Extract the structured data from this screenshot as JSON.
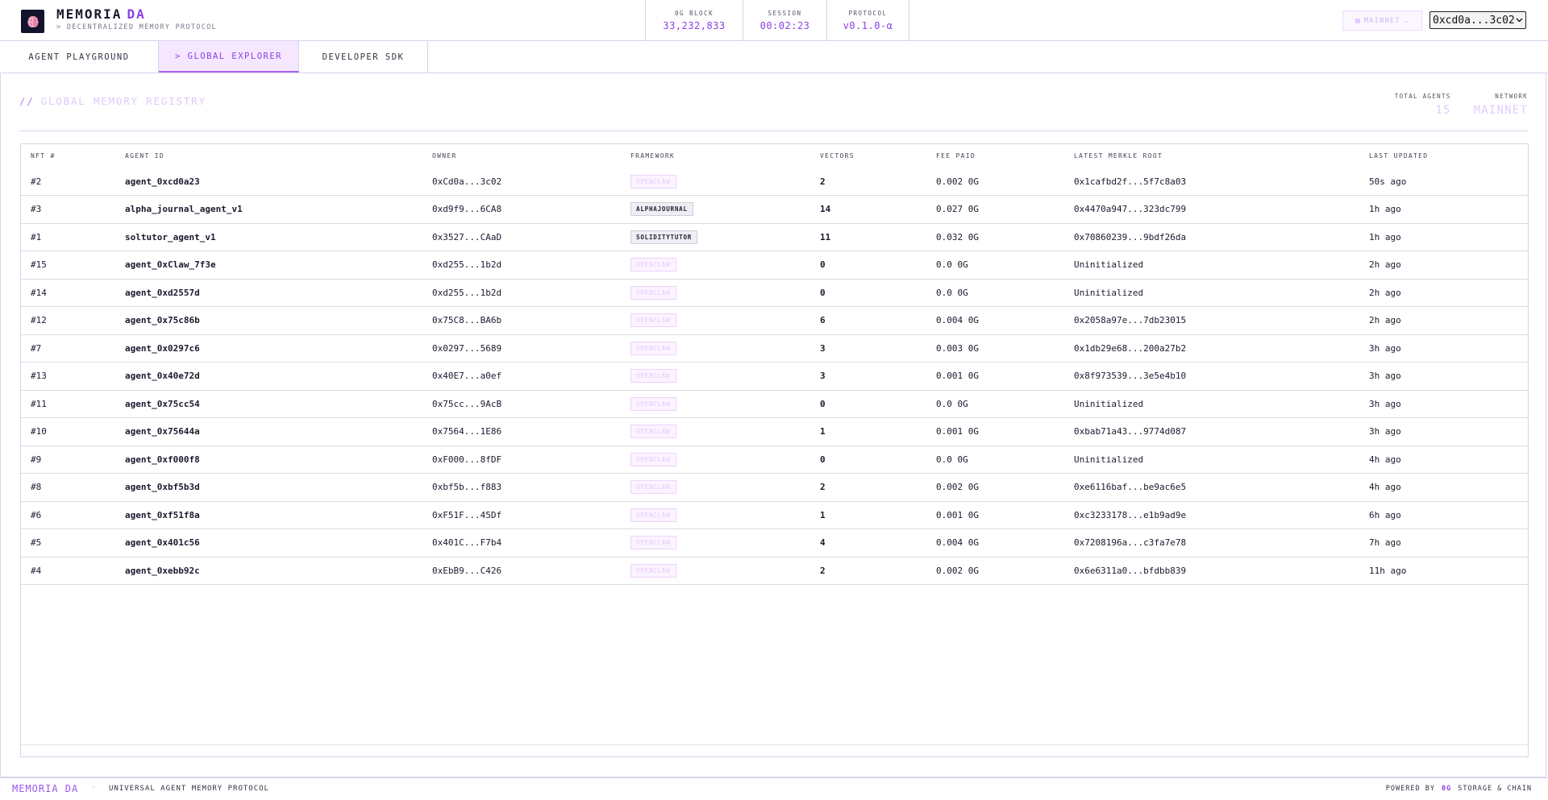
{
  "header": {
    "brand_name": "MEMORIA",
    "brand_accent": "DA",
    "tagline": "> DECENTRALIZED MEMORY PROTOCOL",
    "stats": [
      {
        "label": "0G BLOCK",
        "value": "33,232,833"
      },
      {
        "label": "SESSION",
        "value": "00:02:23"
      },
      {
        "label": "PROTOCOL",
        "value": "v0.1.0-α"
      }
    ],
    "network_button": "MAINNET",
    "wallet": "0xcd0a...3c02"
  },
  "tabs": [
    {
      "label": "AGENT PLAYGROUND",
      "active": false
    },
    {
      "label": "> GLOBAL EXPLORER",
      "active": true
    },
    {
      "label": "DEVELOPER SDK",
      "active": false
    }
  ],
  "registry": {
    "title_prefix": "//",
    "title": "GLOBAL MEMORY REGISTRY",
    "total_agents_label": "TOTAL AGENTS",
    "total_agents": "15",
    "network_label": "NETWORK",
    "network": "MAINNET"
  },
  "table": {
    "columns": [
      "NFT #",
      "AGENT ID",
      "OWNER",
      "FRAMEWORK",
      "VECTORS",
      "FEE PAID",
      "LATEST MERKLE ROOT",
      "LAST UPDATED"
    ],
    "rows": [
      {
        "nft": "#2",
        "agent": "agent_0xcd0a23",
        "owner": "0xCd0a...3c02",
        "framework": "OPENCLAW",
        "vectors": "2",
        "fee": "0.002 0G",
        "root": "0x1cafbd2f...5f7c8a03",
        "updated": "50s ago"
      },
      {
        "nft": "#3",
        "agent": "alpha_journal_agent_v1",
        "owner": "0xd9f9...6CA8",
        "framework": "ALPHAJOURNAL",
        "vectors": "14",
        "fee": "0.027 0G",
        "root": "0x4470a947...323dc799",
        "updated": "1h ago"
      },
      {
        "nft": "#1",
        "agent": "soltutor_agent_v1",
        "owner": "0x3527...CAaD",
        "framework": "SOLIDITYTUTOR",
        "vectors": "11",
        "fee": "0.032 0G",
        "root": "0x70860239...9bdf26da",
        "updated": "1h ago"
      },
      {
        "nft": "#15",
        "agent": "agent_0xClaw_7f3e",
        "owner": "0xd255...1b2d",
        "framework": "OPENCLAW",
        "vectors": "0",
        "fee": "0.0 0G",
        "root": "Uninitialized",
        "updated": "2h ago"
      },
      {
        "nft": "#14",
        "agent": "agent_0xd2557d",
        "owner": "0xd255...1b2d",
        "framework": "OPENCLAW",
        "vectors": "0",
        "fee": "0.0 0G",
        "root": "Uninitialized",
        "updated": "2h ago"
      },
      {
        "nft": "#12",
        "agent": "agent_0x75c86b",
        "owner": "0x75C8...BA6b",
        "framework": "OPENCLAW",
        "vectors": "6",
        "fee": "0.004 0G",
        "root": "0x2058a97e...7db23015",
        "updated": "2h ago"
      },
      {
        "nft": "#7",
        "agent": "agent_0x0297c6",
        "owner": "0x0297...5689",
        "framework": "OPENCLAW",
        "vectors": "3",
        "fee": "0.003 0G",
        "root": "0x1db29e68...200a27b2",
        "updated": "3h ago"
      },
      {
        "nft": "#13",
        "agent": "agent_0x40e72d",
        "owner": "0x40E7...a0ef",
        "framework": "OPENCLAW",
        "vectors": "3",
        "fee": "0.001 0G",
        "root": "0x8f973539...3e5e4b10",
        "updated": "3h ago"
      },
      {
        "nft": "#11",
        "agent": "agent_0x75cc54",
        "owner": "0x75cc...9AcB",
        "framework": "OPENCLAW",
        "vectors": "0",
        "fee": "0.0 0G",
        "root": "Uninitialized",
        "updated": "3h ago"
      },
      {
        "nft": "#10",
        "agent": "agent_0x75644a",
        "owner": "0x7564...1E86",
        "framework": "OPENCLAW",
        "vectors": "1",
        "fee": "0.001 0G",
        "root": "0xbab71a43...9774d087",
        "updated": "3h ago"
      },
      {
        "nft": "#9",
        "agent": "agent_0xf000f8",
        "owner": "0xF000...8fDF",
        "framework": "OPENCLAW",
        "vectors": "0",
        "fee": "0.0 0G",
        "root": "Uninitialized",
        "updated": "4h ago"
      },
      {
        "nft": "#8",
        "agent": "agent_0xbf5b3d",
        "owner": "0xbf5b...f883",
        "framework": "OPENCLAW",
        "vectors": "2",
        "fee": "0.002 0G",
        "root": "0xe6116baf...be9ac6e5",
        "updated": "4h ago"
      },
      {
        "nft": "#6",
        "agent": "agent_0xf51f8a",
        "owner": "0xF51F...45Df",
        "framework": "OPENCLAW",
        "vectors": "1",
        "fee": "0.001 0G",
        "root": "0xc3233178...e1b9ad9e",
        "updated": "6h ago"
      },
      {
        "nft": "#5",
        "agent": "agent_0x401c56",
        "owner": "0x401C...F7b4",
        "framework": "OPENCLAW",
        "vectors": "4",
        "fee": "0.004 0G",
        "root": "0x7208196a...c3fa7e78",
        "updated": "7h ago"
      },
      {
        "nft": "#4",
        "agent": "agent_0xebb92c",
        "owner": "0xEbB9...C426",
        "framework": "OPENCLAW",
        "vectors": "2",
        "fee": "0.002 0G",
        "root": "0x6e6311a0...bfdbb839",
        "updated": "11h ago"
      }
    ]
  },
  "footer": {
    "brand": "MEMORIA DA",
    "separator": "·",
    "description": "UNIVERSAL AGENT MEMORY PROTOCOL",
    "powered_by": "POWERED BY",
    "og": "0G",
    "storage": "STORAGE & CHAIN"
  },
  "colors": {
    "accent": "#8b3fe6",
    "logo_bg": "#13132b",
    "tab_active_bg": "#f4e7ff",
    "border": "#d9d3ea"
  },
  "icons": {
    "logo": "brain-icon",
    "network_dot": "status-dot-icon",
    "dropdown": "chevron-down-icon"
  }
}
